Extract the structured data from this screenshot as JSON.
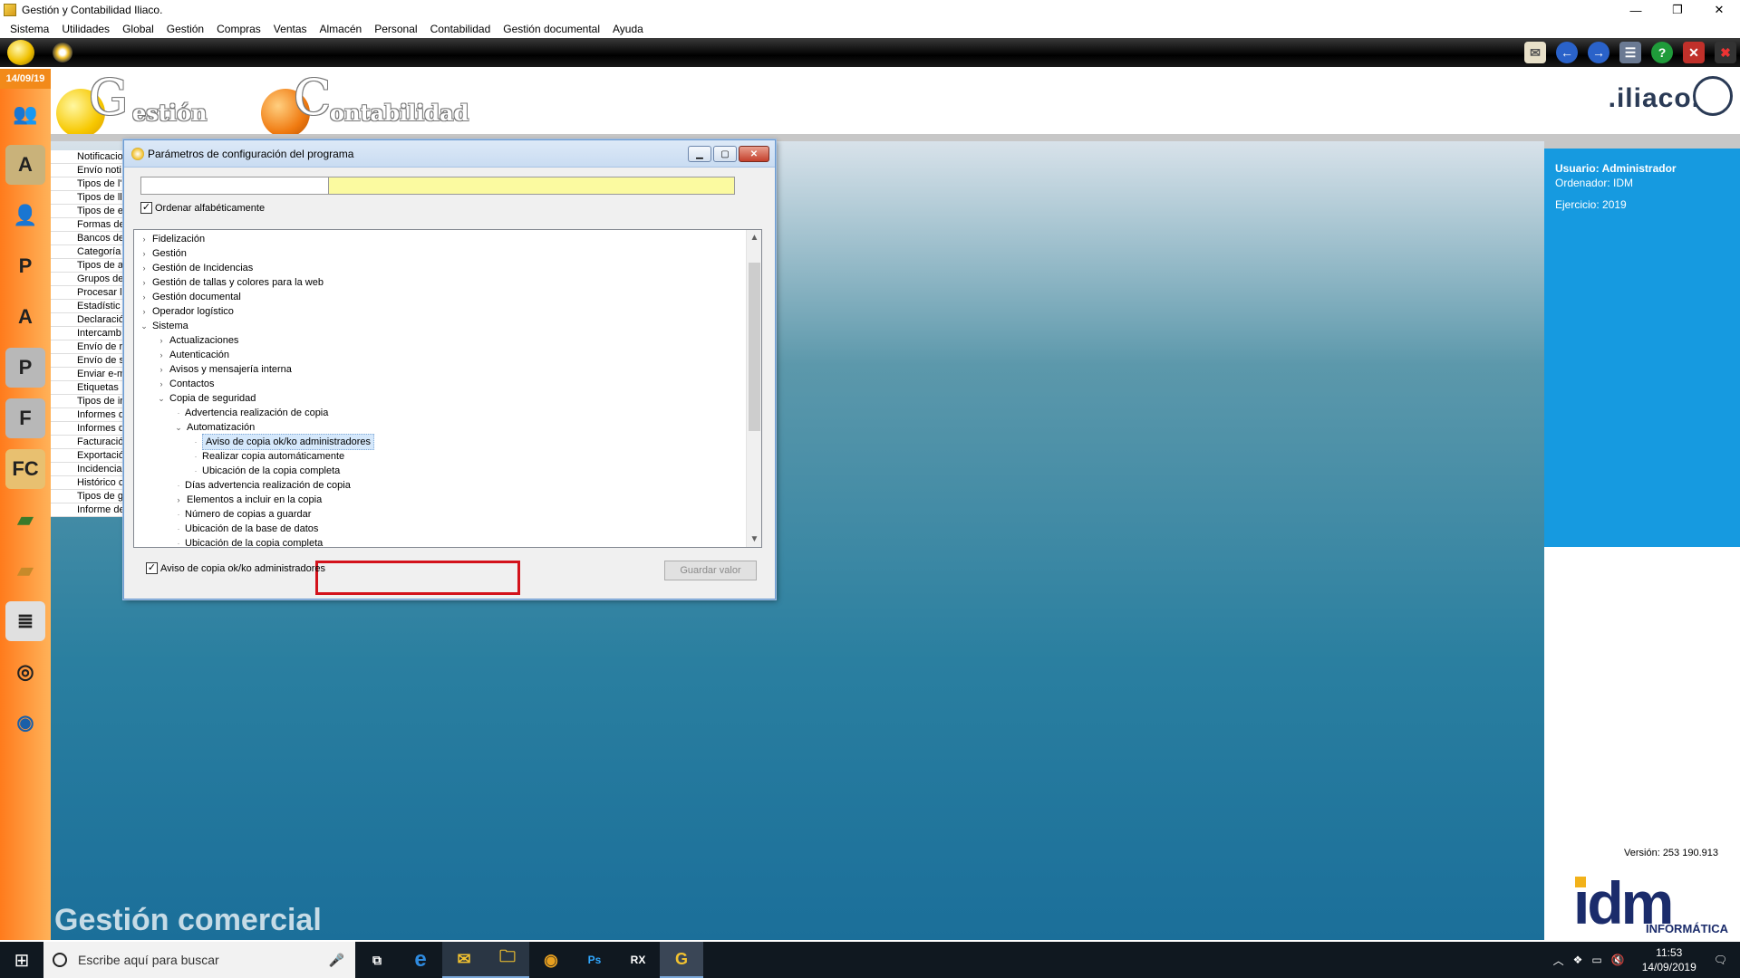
{
  "window": {
    "title": "Gestión y Contabilidad Iliaco.",
    "minimize": "—",
    "restore": "❐",
    "close": "✕"
  },
  "menu": [
    "Sistema",
    "Utilidades",
    "Global",
    "Gestión",
    "Compras",
    "Ventas",
    "Almacén",
    "Personal",
    "Contabilidad",
    "Gestión documental",
    "Ayuda"
  ],
  "date": "14/09/19",
  "header": {
    "gestion_word": "estión",
    "gestion_letter": "G",
    "contab_word": "ontabilidad",
    "contab_letter": "C",
    "brand": ".iliaco."
  },
  "left_list": [
    "Notificacio",
    "Envío noti",
    "Tipos de l'",
    "Tipos de ll",
    "Tipos de e",
    "Formas de",
    "Bancos de",
    "Categoría",
    "Tipos de a",
    "Grupos de",
    "Procesar l",
    "Estadístic",
    "Declaració",
    "Intercamb",
    "Envío de r",
    "Envío de s",
    "Enviar e-m",
    "Etiquetas",
    "Tipos de in",
    "Informes d",
    "Informes d",
    "Facturació",
    "Exportació",
    "Incidencia",
    "Histórico c",
    "Tipos de g",
    "Informe de"
  ],
  "module_title": "Gestión comercial",
  "user_panel": {
    "usuario": "Usuario: Administrador",
    "ordenador": "Ordenador: IDM",
    "ejercicio": "Ejercicio: 2019",
    "version": "Versión: 253 190.913"
  },
  "idm_logo": {
    "text": "idm",
    "sub": "INFORMÁTICA"
  },
  "dialog": {
    "title": "Parámetros de configuración del programa",
    "search_value": "",
    "sort_label": "Ordenar alfabéticamente",
    "sort_checked": true,
    "tree": [
      {
        "label": "Fidelización",
        "level": 0,
        "state": "collapsed"
      },
      {
        "label": "Gestión",
        "level": 0,
        "state": "collapsed"
      },
      {
        "label": "Gestión de Incidencias",
        "level": 0,
        "state": "collapsed"
      },
      {
        "label": "Gestión de tallas y colores para la web",
        "level": 0,
        "state": "collapsed"
      },
      {
        "label": "Gestión documental",
        "level": 0,
        "state": "collapsed"
      },
      {
        "label": "Operador logístico",
        "level": 0,
        "state": "collapsed"
      },
      {
        "label": "Sistema",
        "level": 0,
        "state": "expanded"
      },
      {
        "label": "Actualizaciones",
        "level": 1,
        "state": "collapsed"
      },
      {
        "label": "Autenticación",
        "level": 1,
        "state": "collapsed"
      },
      {
        "label": "Avisos y mensajería interna",
        "level": 1,
        "state": "collapsed"
      },
      {
        "label": "Contactos",
        "level": 1,
        "state": "collapsed"
      },
      {
        "label": "Copia de seguridad",
        "level": 1,
        "state": "expanded"
      },
      {
        "label": "Advertencia realización de copia",
        "level": 2,
        "state": "leaf"
      },
      {
        "label": "Automatización",
        "level": 2,
        "state": "expanded"
      },
      {
        "label": "Aviso de copia ok/ko administradores",
        "level": 3,
        "state": "leaf",
        "selected": true
      },
      {
        "label": "Realizar copia automáticamente",
        "level": 3,
        "state": "leaf"
      },
      {
        "label": "Ubicación de la copia completa",
        "level": 3,
        "state": "leaf"
      },
      {
        "label": "Días advertencia realización de copia",
        "level": 2,
        "state": "leaf"
      },
      {
        "label": "Elementos a incluir en la copia",
        "level": 2,
        "state": "collapsed"
      },
      {
        "label": "Número de copias a guardar",
        "level": 2,
        "state": "leaf"
      },
      {
        "label": "Ubicación de la base de datos",
        "level": 2,
        "state": "leaf"
      },
      {
        "label": "Ubicación de la copia completa",
        "level": 2,
        "state": "leaf"
      }
    ],
    "value_label": "Aviso de copia ok/ko administradores",
    "value_checked": true,
    "save_button": "Guardar valor"
  },
  "taskbar": {
    "search_placeholder": "Escribe aquí para buscar",
    "time": "11:53",
    "date": "14/09/2019",
    "apps": [
      "e",
      "✉",
      "🗀",
      "◉",
      "Ps",
      "RX",
      "G"
    ]
  },
  "colors": {
    "accent_blue": "#169ae0",
    "selection_red": "#d3121b",
    "sidebar_orange": "#ff7b1c"
  }
}
